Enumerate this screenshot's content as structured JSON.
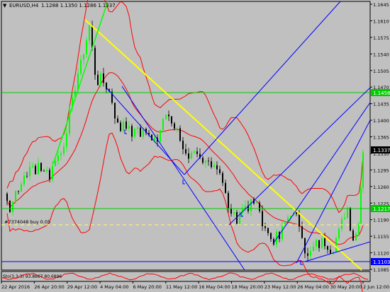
{
  "header": {
    "arrow": "▼",
    "symbol_timeframe": "EURUSD,H4",
    "ohlc": "1.1288 1.1350 1.1286 1.1337"
  },
  "order_label": "#7374048 buy 0.05",
  "indicator_label": "Sto(3,3,3) 93.8667 80.6896",
  "price_axis": {
    "ticks": [
      "1.1645",
      "1.1610",
      "1.1575",
      "1.1540",
      "1.1505",
      "1.1470",
      "1.1435",
      "1.1400",
      "1.1365",
      "1.1330",
      "1.1295",
      "1.1260",
      "1.1225",
      "1.1190",
      "1.1155",
      "1.1120",
      "1.1085"
    ],
    "current_price": "1.1337",
    "green_level_top": "1.1458",
    "green_level_bottom": "1.1217",
    "blue_level": "1.1103",
    "order_level": "1.1193"
  },
  "time_axis": [
    "22 Apr 2016",
    "26 Apr 20:00",
    "29 Apr 12:00",
    "4 May 04:00",
    "6 May 20:00",
    "11 May 12:00",
    "16 May 04:00",
    "18 May 20:00",
    "23 May 12:00",
    "26 May 04:00",
    "30 May 20:00",
    "2 Jun 12:00"
  ],
  "colors": {
    "background": "#c0c0c0",
    "bull_candle": "#00ff00",
    "bear_candle": "#000000",
    "bollinger": "#ff0000",
    "trendline_yellow": "#ffff00",
    "channel_blue": "#0000ff",
    "level_green": "#00cc00",
    "order_line": "#ffff00"
  },
  "chart_data": {
    "type": "candlestick",
    "symbol": "EURUSD",
    "timeframe": "H4",
    "ylim": [
      1.1085,
      1.1645
    ],
    "x": [
      "22 Apr 2016",
      "26 Apr 20:00",
      "29 Apr 12:00",
      "4 May 04:00",
      "6 May 20:00",
      "11 May 12:00",
      "16 May 04:00",
      "18 May 20:00",
      "23 May 12:00",
      "26 May 04:00",
      "30 May 20:00",
      "2 Jun 12:00"
    ],
    "close_path": [
      [
        0,
        1.1245
      ],
      [
        4,
        1.123
      ],
      [
        8,
        1.1205
      ],
      [
        12,
        1.1235
      ],
      [
        16,
        1.1255
      ],
      [
        20,
        1.125
      ],
      [
        24,
        1.1265
      ],
      [
        28,
        1.129
      ],
      [
        32,
        1.1275
      ],
      [
        36,
        1.13
      ],
      [
        40,
        1.1305
      ],
      [
        44,
        1.129
      ],
      [
        48,
        1.1305
      ],
      [
        52,
        1.129
      ],
      [
        56,
        1.13
      ],
      [
        60,
        1.1295
      ],
      [
        64,
        1.128
      ],
      [
        68,
        1.13
      ],
      [
        72,
        1.132
      ],
      [
        76,
        1.1325
      ],
      [
        80,
        1.133
      ],
      [
        84,
        1.135
      ],
      [
        88,
        1.138
      ],
      [
        92,
        1.142
      ],
      [
        96,
        1.144
      ],
      [
        100,
        1.147
      ],
      [
        104,
        1.15
      ],
      [
        108,
        1.152
      ],
      [
        112,
        1.1545
      ],
      [
        116,
        1.157
      ],
      [
        120,
        1.16
      ],
      [
        124,
        1.155
      ],
      [
        128,
        1.15
      ],
      [
        132,
        1.148
      ],
      [
        136,
        1.149
      ],
      [
        140,
        1.148
      ],
      [
        144,
        1.147
      ],
      [
        148,
        1.146
      ],
      [
        152,
        1.144
      ],
      [
        156,
        1.141
      ],
      [
        160,
        1.139
      ],
      [
        164,
        1.138
      ],
      [
        168,
        1.14
      ],
      [
        172,
        1.139
      ],
      [
        176,
        1.138
      ],
      [
        180,
        1.137
      ],
      [
        184,
        1.1375
      ],
      [
        188,
        1.1385
      ],
      [
        192,
        1.137
      ],
      [
        196,
        1.138
      ],
      [
        200,
        1.1375
      ],
      [
        204,
        1.1365
      ],
      [
        208,
        1.1355
      ],
      [
        212,
        1.137
      ],
      [
        216,
        1.136
      ],
      [
        220,
        1.138
      ],
      [
        224,
        1.141
      ],
      [
        228,
        1.142
      ],
      [
        232,
        1.141
      ],
      [
        236,
        1.139
      ],
      [
        240,
        1.138
      ],
      [
        244,
        1.1375
      ],
      [
        248,
        1.136
      ],
      [
        252,
        1.134
      ],
      [
        256,
        1.133
      ],
      [
        260,
        1.132
      ],
      [
        264,
        1.1325
      ],
      [
        268,
        1.1335
      ],
      [
        272,
        1.133
      ],
      [
        276,
        1.1325
      ],
      [
        280,
        1.1315
      ],
      [
        284,
        1.131
      ],
      [
        288,
        1.132
      ],
      [
        292,
        1.1305
      ],
      [
        296,
        1.13
      ],
      [
        300,
        1.129
      ],
      [
        304,
        1.128
      ],
      [
        308,
        1.126
      ],
      [
        312,
        1.124
      ],
      [
        316,
        1.121
      ],
      [
        320,
        1.12
      ],
      [
        324,
        1.1205
      ],
      [
        328,
        1.119
      ],
      [
        332,
        1.121
      ],
      [
        336,
        1.1215
      ],
      [
        340,
        1.1225
      ],
      [
        344,
        1.121
      ],
      [
        348,
        1.123
      ],
      [
        352,
        1.122
      ],
      [
        356,
        1.123
      ],
      [
        360,
        1.12
      ],
      [
        364,
        1.1185
      ],
      [
        368,
        1.1175
      ],
      [
        372,
        1.116
      ],
      [
        376,
        1.115
      ],
      [
        380,
        1.1145
      ],
      [
        384,
        1.1155
      ],
      [
        388,
        1.115
      ],
      [
        392,
        1.117
      ],
      [
        396,
        1.1185
      ],
      [
        400,
        1.1195
      ],
      [
        404,
        1.1205
      ],
      [
        408,
        1.12
      ],
      [
        412,
        1.1195
      ],
      [
        416,
        1.118
      ],
      [
        420,
        1.116
      ],
      [
        424,
        1.1125
      ],
      [
        428,
        1.111
      ],
      [
        432,
        1.112
      ],
      [
        436,
        1.113
      ],
      [
        440,
        1.114
      ],
      [
        444,
        1.1135
      ],
      [
        448,
        1.1145
      ],
      [
        452,
        1.114
      ],
      [
        456,
        1.1135
      ],
      [
        460,
        1.1125
      ],
      [
        464,
        1.113
      ],
      [
        468,
        1.115
      ],
      [
        472,
        1.1165
      ],
      [
        476,
        1.1185
      ],
      [
        480,
        1.12
      ],
      [
        484,
        1.1215
      ],
      [
        488,
        1.1175
      ],
      [
        492,
        1.115
      ],
      [
        496,
        1.116
      ],
      [
        500,
        1.119
      ],
      [
        503,
        1.126
      ],
      [
        506,
        1.1337
      ]
    ],
    "indicators": [
      "Bollinger Bands",
      "Stochastic(3,3,3)"
    ],
    "grid": false
  }
}
